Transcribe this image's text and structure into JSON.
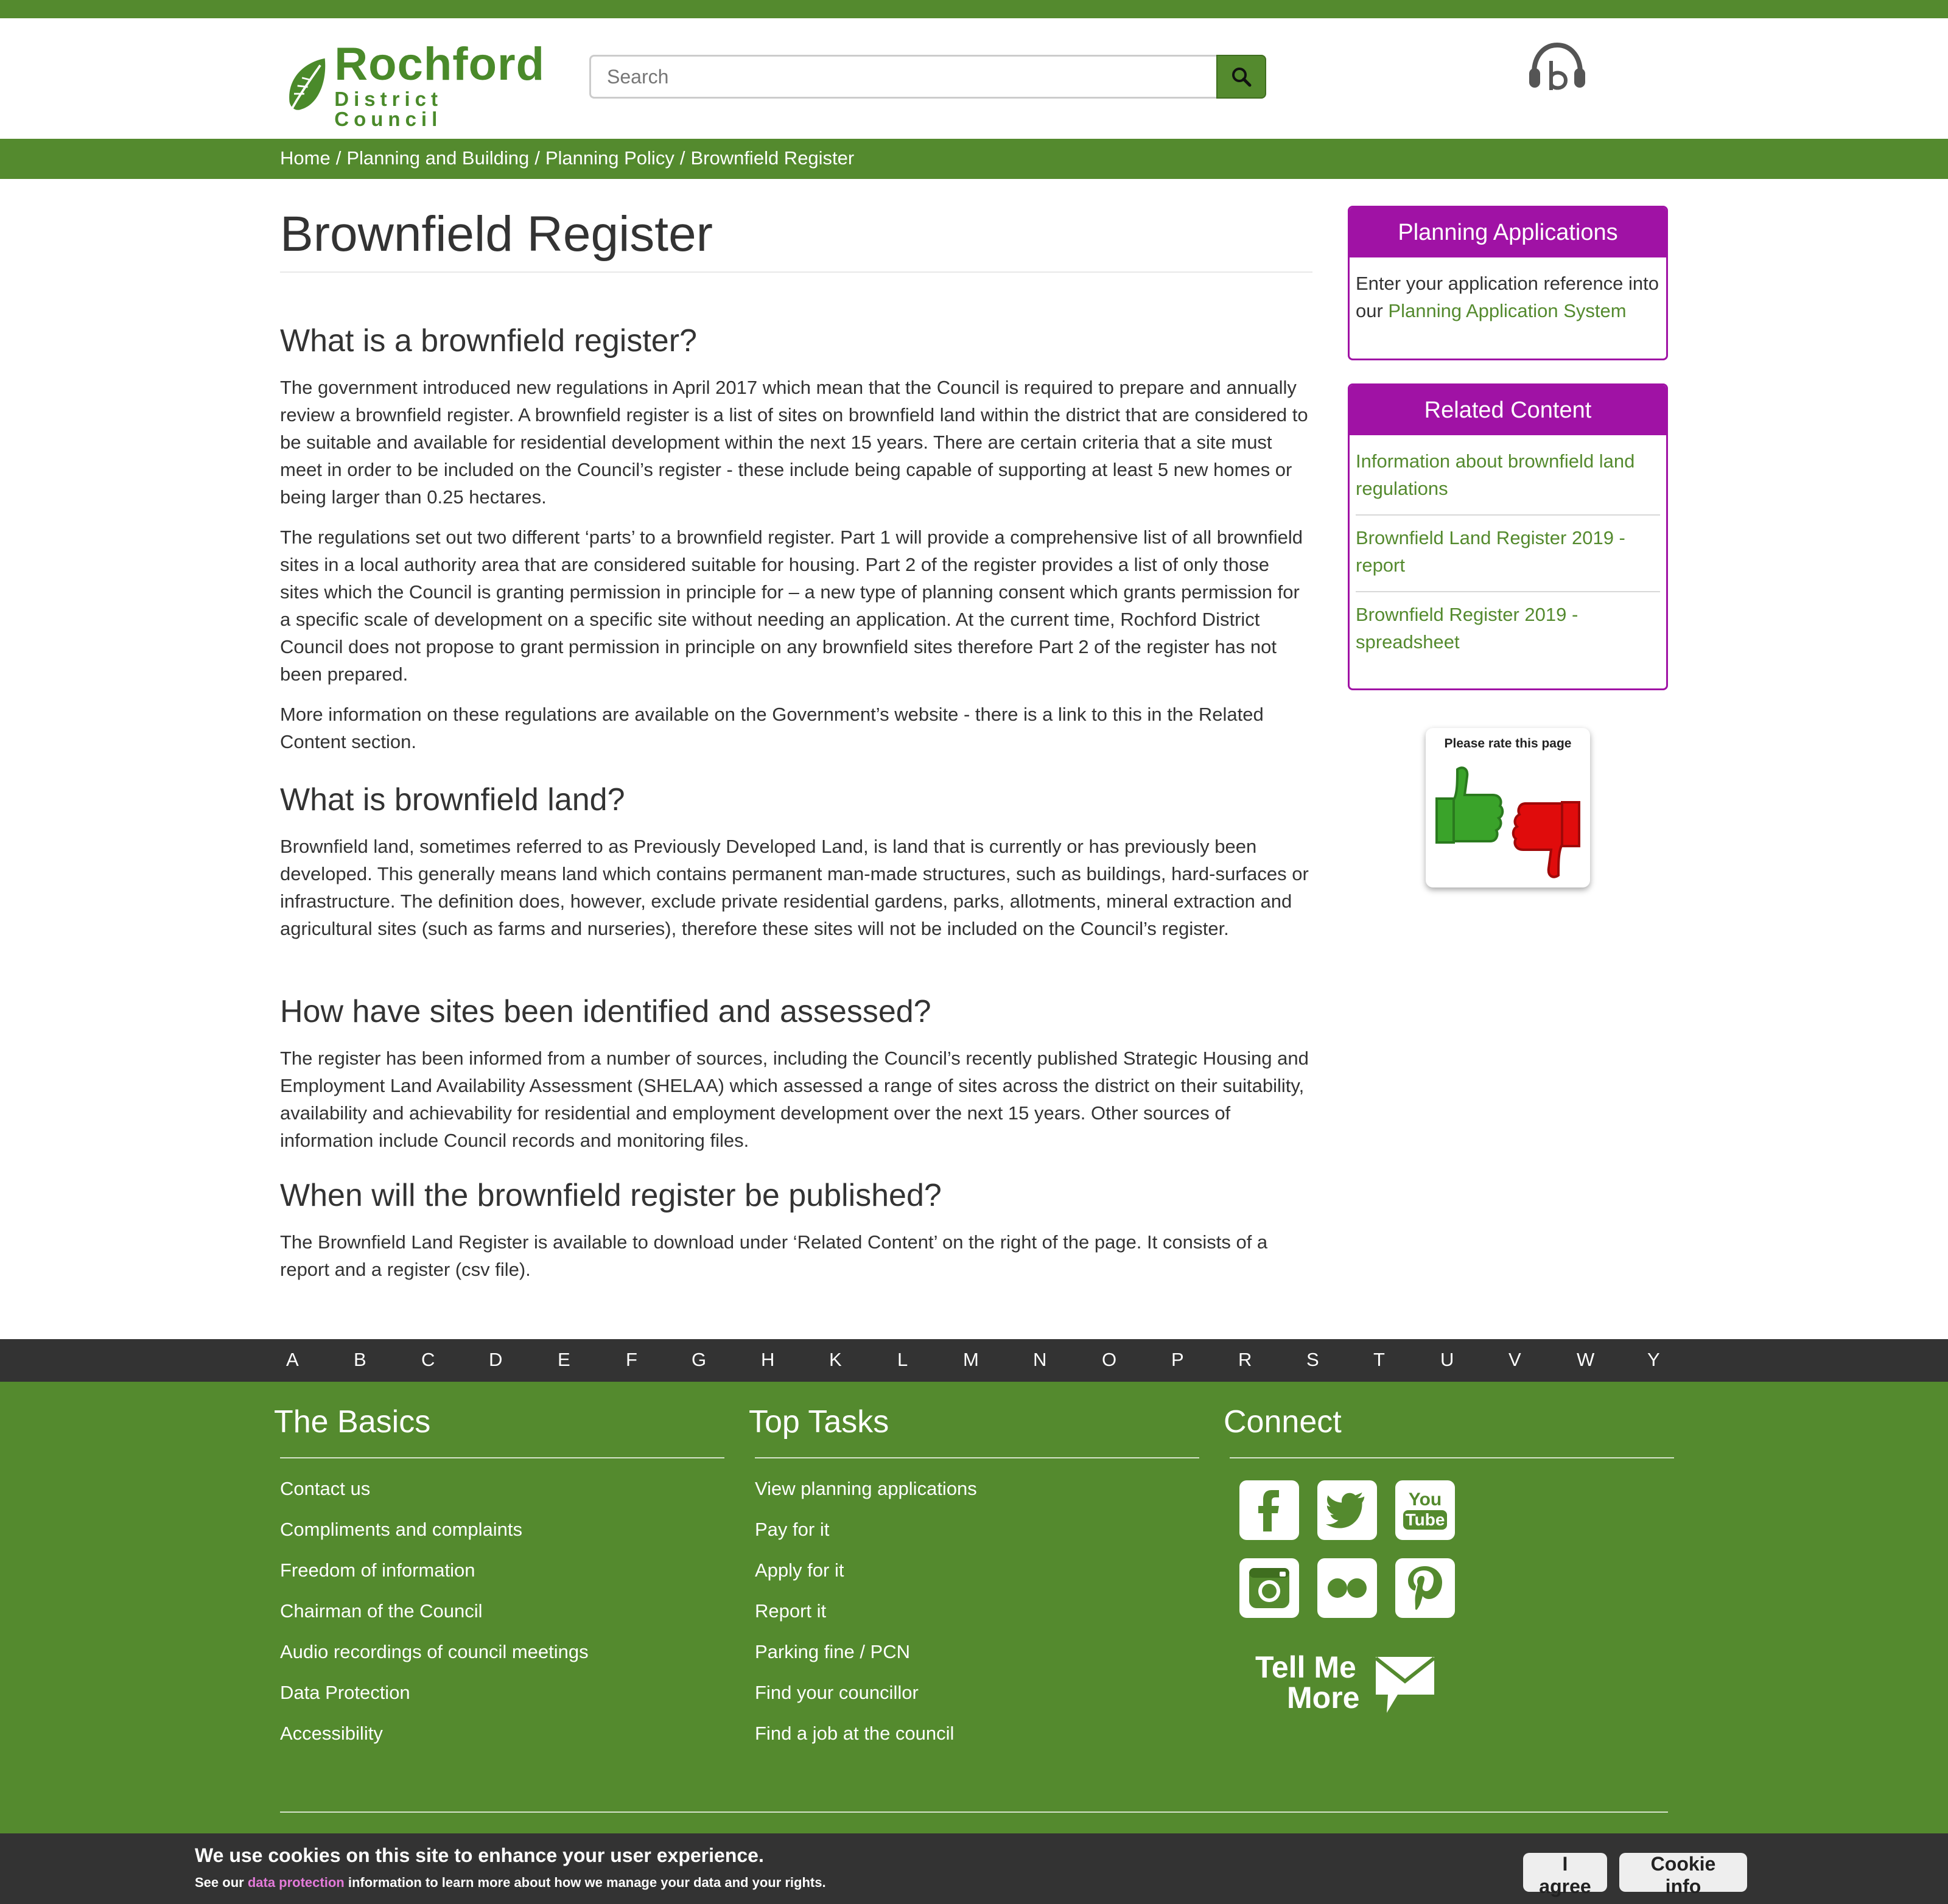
{
  "header": {
    "logo_name": "Rochford",
    "logo_sub": "District Council",
    "search_placeholder": "Search"
  },
  "breadcrumb": [
    "Home",
    "Planning and Building",
    "Planning Policy",
    "Brownfield Register"
  ],
  "breadcrumb_sep": "/",
  "main": {
    "title": "Brownfield Register",
    "sections": [
      {
        "heading": "What is a brownfield register?",
        "paragraphs": [
          "The government introduced new regulations in April 2017 which mean that the Council is required to prepare and annually review a brownfield register. A brownfield register is a list of sites on brownfield land within the district that are considered to be suitable and available for residential development within the next 15 years. There are certain criteria that a site must meet in order to be included on the Council’s register - these include being capable of supporting at least 5 new homes or being larger than 0.25 hectares.",
          "The regulations set out two different ‘parts’ to a brownfield register. Part 1 will provide a comprehensive list of all brownfield sites in a local authority area that are considered suitable for housing. Part 2 of the register provides a list of only those sites which the Council is granting permission in principle for – a new type of planning consent which grants permission for a specific scale of development on a specific site without needing an application. At the current time, Rochford District Council does not propose to grant permission in principle on any brownfield sites therefore Part 2 of the register has not been prepared.",
          "More information on these regulations are available on the Government’s website - there is a link to this in the Related Content section."
        ]
      },
      {
        "heading": "What is brownfield land?",
        "paragraphs": [
          "Brownfield land, sometimes referred to as Previously Developed Land, is land that is currently or has previously been developed. This generally means land which contains permanent man-made structures, such as buildings, hard-surfaces or infrastructure. The definition does, however, exclude private residential gardens, parks, allotments, mineral extraction and agricultural sites (such as farms and nurseries), therefore these sites will not be included on the Council’s register."
        ]
      },
      {
        "heading": "How have sites been identified and assessed?",
        "paragraphs": [
          "The register has been informed from a number of sources, including the Council’s recently published Strategic Housing and Employment Land Availability Assessment (SHELAA) which assessed a range of sites across the district on their suitability, availability and achievability for residential and employment development over the next 15 years. Other sources of information include Council records and monitoring files."
        ]
      },
      {
        "heading": "When will the brownfield register be published?",
        "paragraphs": [
          "The Brownfield Land Register is available to download under ‘Related Content’ on the right of the page. It consists of a report and a register (csv file)."
        ]
      }
    ]
  },
  "sidebar": {
    "planning": {
      "title": "Planning Applications",
      "text": "Enter your application reference into our ",
      "link": "Planning Application System"
    },
    "related": {
      "title": "Related Content",
      "links": [
        "Information about brownfield land regulations",
        "Brownfield Land Register 2019 - report",
        "Brownfield Register 2019 - spreadsheet"
      ]
    },
    "rate_title": "Please rate this page"
  },
  "alphabet": [
    "A",
    "B",
    "C",
    "D",
    "E",
    "F",
    "G",
    "H",
    "K",
    "L",
    "M",
    "N",
    "O",
    "P",
    "R",
    "S",
    "T",
    "U",
    "V",
    "W",
    "Y"
  ],
  "footer": {
    "basics": {
      "title": "The Basics",
      "links": [
        "Contact us",
        "Compliments and complaints",
        "Freedom of information",
        "Chairman of the Council",
        "Audio recordings of council meetings",
        "Data Protection",
        "Accessibility"
      ]
    },
    "tasks": {
      "title": "Top Tasks",
      "links": [
        "View planning applications",
        "Pay for it",
        "Apply for it",
        "Report it",
        "Parking fine / PCN",
        "Find your councillor",
        "Find a job at the council"
      ]
    },
    "connect": {
      "title": "Connect",
      "social": [
        "facebook-icon",
        "twitter-icon",
        "youtube-icon",
        "instagram-icon",
        "flickr-icon",
        "pinterest-icon"
      ],
      "tellme_line1": "Tell Me",
      "tellme_line2": "More",
      "youtube_top": "You",
      "youtube_bottom": "Tube"
    }
  },
  "cookie": {
    "title": "We use cookies on this site to enhance your user experience.",
    "sub_before": "See our ",
    "sub_link": "data protection",
    "sub_after": " information to learn more about how we manage your data and your rights.",
    "agree": "I agree",
    "info": "Cookie info"
  },
  "colors": {
    "brand_green": "#548a2e",
    "accent_purple": "#a012a5",
    "dark_bar": "#333333"
  }
}
